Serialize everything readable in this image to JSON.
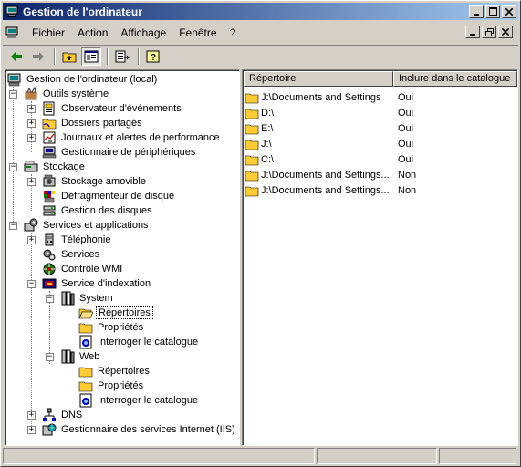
{
  "window": {
    "title": "Gestion de l'ordinateur"
  },
  "menu": [
    "Fichier",
    "Action",
    "Affichage",
    "Fenêtre",
    "?"
  ],
  "toolbar": {
    "buttons": [
      "back-arrow-icon",
      "forward-arrow-icon",
      "up-folder-icon",
      "show-hide-tree-icon",
      "export-list-icon",
      "help-icon"
    ]
  },
  "tree": {
    "root": "Gestion de l'ordinateur (local)",
    "items": [
      "Outils système",
      "Observateur d'événements",
      "Dossiers partagés",
      "Journaux et alertes de performance",
      "Gestionnaire de périphériques",
      "Stockage",
      "Stockage amovible",
      "Défragmenteur de disque",
      "Gestion des disques",
      "Services et applications",
      "Téléphonie",
      "Services",
      "Contrôle WMI",
      "Service d'indexation",
      "System",
      "Répertoires",
      "Propriétés",
      "Interroger le catalogue",
      "Web",
      "Répertoires",
      "Propriétés",
      "Interroger le catalogue",
      "DNS",
      "Gestionnaire des services Internet (IIS)"
    ]
  },
  "list": {
    "columns": [
      "Répertoire",
      "Inclure dans le catalogue"
    ],
    "rows": [
      [
        "J:\\Documents and Settings",
        "Oui"
      ],
      [
        "D:\\",
        "Oui"
      ],
      [
        "E:\\",
        "Oui"
      ],
      [
        "J:\\",
        "Oui"
      ],
      [
        "C:\\",
        "Oui"
      ],
      [
        "J:\\Documents and Settings...",
        "Non"
      ],
      [
        "J:\\Documents and Settings...",
        "Non"
      ]
    ]
  }
}
